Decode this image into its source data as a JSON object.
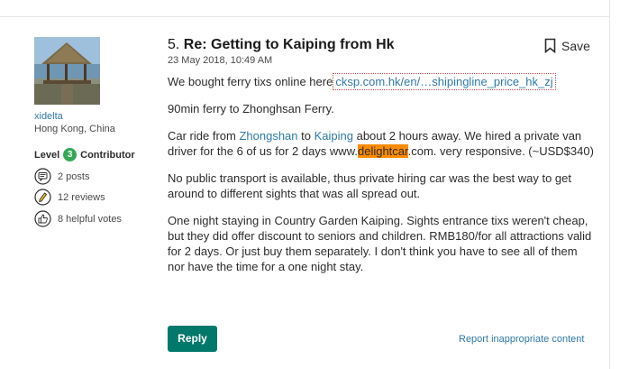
{
  "user": {
    "name": "xidelta",
    "location": "Hong Kong, China",
    "level_label": "Level",
    "level_value": "3",
    "level_suffix": "Contributor",
    "stats": [
      {
        "icon": "posts-icon",
        "text": "2 posts"
      },
      {
        "icon": "reviews-icon",
        "text": "12 reviews"
      },
      {
        "icon": "helpful-votes-icon",
        "text": "8 helpful votes"
      }
    ]
  },
  "post": {
    "number": "5.",
    "title": "Re: Getting to Kaiping from Hk",
    "date": "23 May 2018, 10:49 AM",
    "save_label": "Save",
    "p1_text": "We bought ferry tixs online here",
    "p1_link": "cksp.com.hk/en/…shipingline_price_hk_zj",
    "p2": "90min ferry to Zhonghsan Ferry.",
    "p3_a": "Car ride from ",
    "p3_link1": "Zhongshan",
    "p3_b": " to ",
    "p3_link2": "Kaiping",
    "p3_c": " about 2 hours away. We hired a private van driver for the 6 of us for 2 days www.",
    "p3_highlight": "delightcar",
    "p3_d": ".com. very responsive. (~USD$340)",
    "p4": "No public transport is available, thus private hiring car was the best way to get around to different sights that was all spread out.",
    "p5": "One night staying in Country Garden Kaiping. Sights entrance tixs weren't cheap, but they did offer discount to seniors and children. RMB180/for all attractions valid for 2 days. Or just buy them separately. I don't think you have to see all of them nor have the time for a one night stay."
  },
  "actions": {
    "reply_label": "Reply",
    "report_label": "Report inappropriate content"
  },
  "colors": {
    "reply_bg": "#00786a",
    "link": "#2f7aa8",
    "highlight": "#ff8c00",
    "level_badge": "#34a854"
  }
}
